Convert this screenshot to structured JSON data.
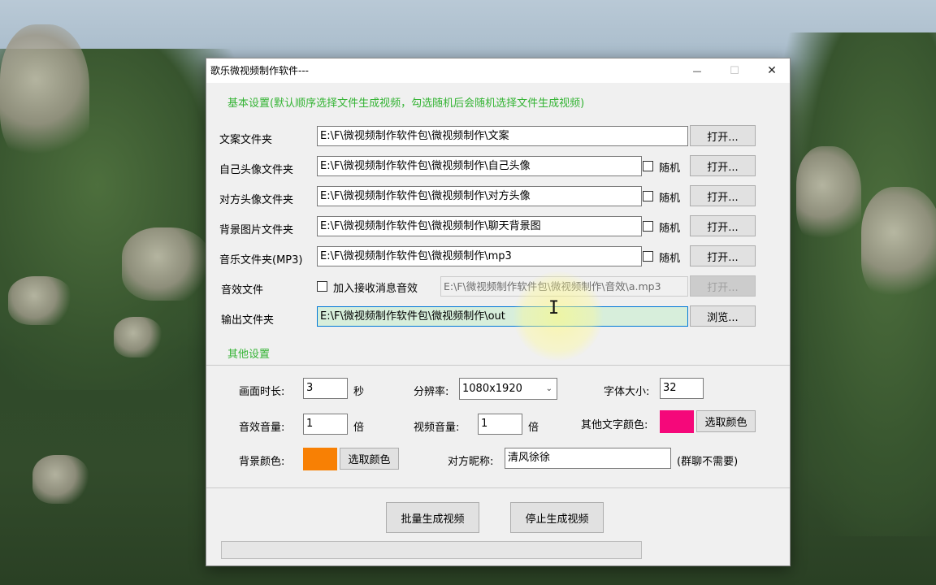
{
  "window": {
    "title": "歌乐微视频制作软件---",
    "minimize_glyph": "—",
    "maximize_glyph": "☐",
    "close_glyph": "✕"
  },
  "basic_section": {
    "heading": "基本设置(默认顺序选择文件生成视频，勾选随机后会随机选择文件生成视频)"
  },
  "rows": [
    {
      "label": "文案文件夹",
      "value": "E:\\F\\微视频制作软件包\\微视频制作\\文案",
      "button": "打开..."
    },
    {
      "label": "自己头像文件夹",
      "value": "E:\\F\\微视频制作软件包\\微视频制作\\自己头像",
      "random_label": "随机",
      "button": "打开..."
    },
    {
      "label": "对方头像文件夹",
      "value": "E:\\F\\微视频制作软件包\\微视频制作\\对方头像",
      "random_label": "随机",
      "button": "打开..."
    },
    {
      "label": "背景图片文件夹",
      "value": "E:\\F\\微视频制作软件包\\微视频制作\\聊天背景图",
      "random_label": "随机",
      "button": "打开..."
    },
    {
      "label": "音乐文件夹(MP3)",
      "value": "E:\\F\\微视频制作软件包\\微视频制作\\mp3",
      "random_label": "随机",
      "button": "打开..."
    },
    {
      "label": "音效文件",
      "checkbox_label": "加入接收消息音效",
      "value": "E:\\F\\微视频制作软件包\\微视频制作\\音效\\a.mp3",
      "button": "打开..."
    },
    {
      "label": "输出文件夹",
      "value": "E:\\F\\微视频制作软件包\\微视频制作\\out",
      "button": "浏览..."
    }
  ],
  "other_section": {
    "heading": "其他设置"
  },
  "settings": {
    "duration_label": "画面时长:",
    "duration_value": "3",
    "duration_unit": "秒",
    "resolution_label": "分辨率:",
    "resolution_value": "1080x1920",
    "font_size_label": "字体大小:",
    "font_size_value": "32",
    "sfx_volume_label": "音效音量:",
    "sfx_volume_value": "1",
    "sfx_volume_unit": "倍",
    "video_volume_label": "视频音量:",
    "video_volume_value": "1",
    "video_volume_unit": "倍",
    "other_text_color_label": "其他文字颜色:",
    "other_text_color": "#f5087a",
    "pick_color_button": "选取颜色",
    "bg_color_label": "背景颜色:",
    "bg_color": "#f88004",
    "bg_pick_color_button": "选取颜色",
    "nickname_label": "对方昵称:",
    "nickname_value": "清风徐徐",
    "nickname_note": "(群聊不需要)"
  },
  "actions": {
    "batch_generate": "批量生成视频",
    "stop_generate": "停止生成视频"
  },
  "progress": {
    "value": 0
  },
  "colors": {
    "section_heading": "#33b333",
    "input_focus_border": "#0078d7"
  },
  "icons": {
    "checkbox": "checkbox-icon",
    "dropdown": "chevron-down-icon",
    "text_cursor": "i-beam-cursor-icon"
  }
}
